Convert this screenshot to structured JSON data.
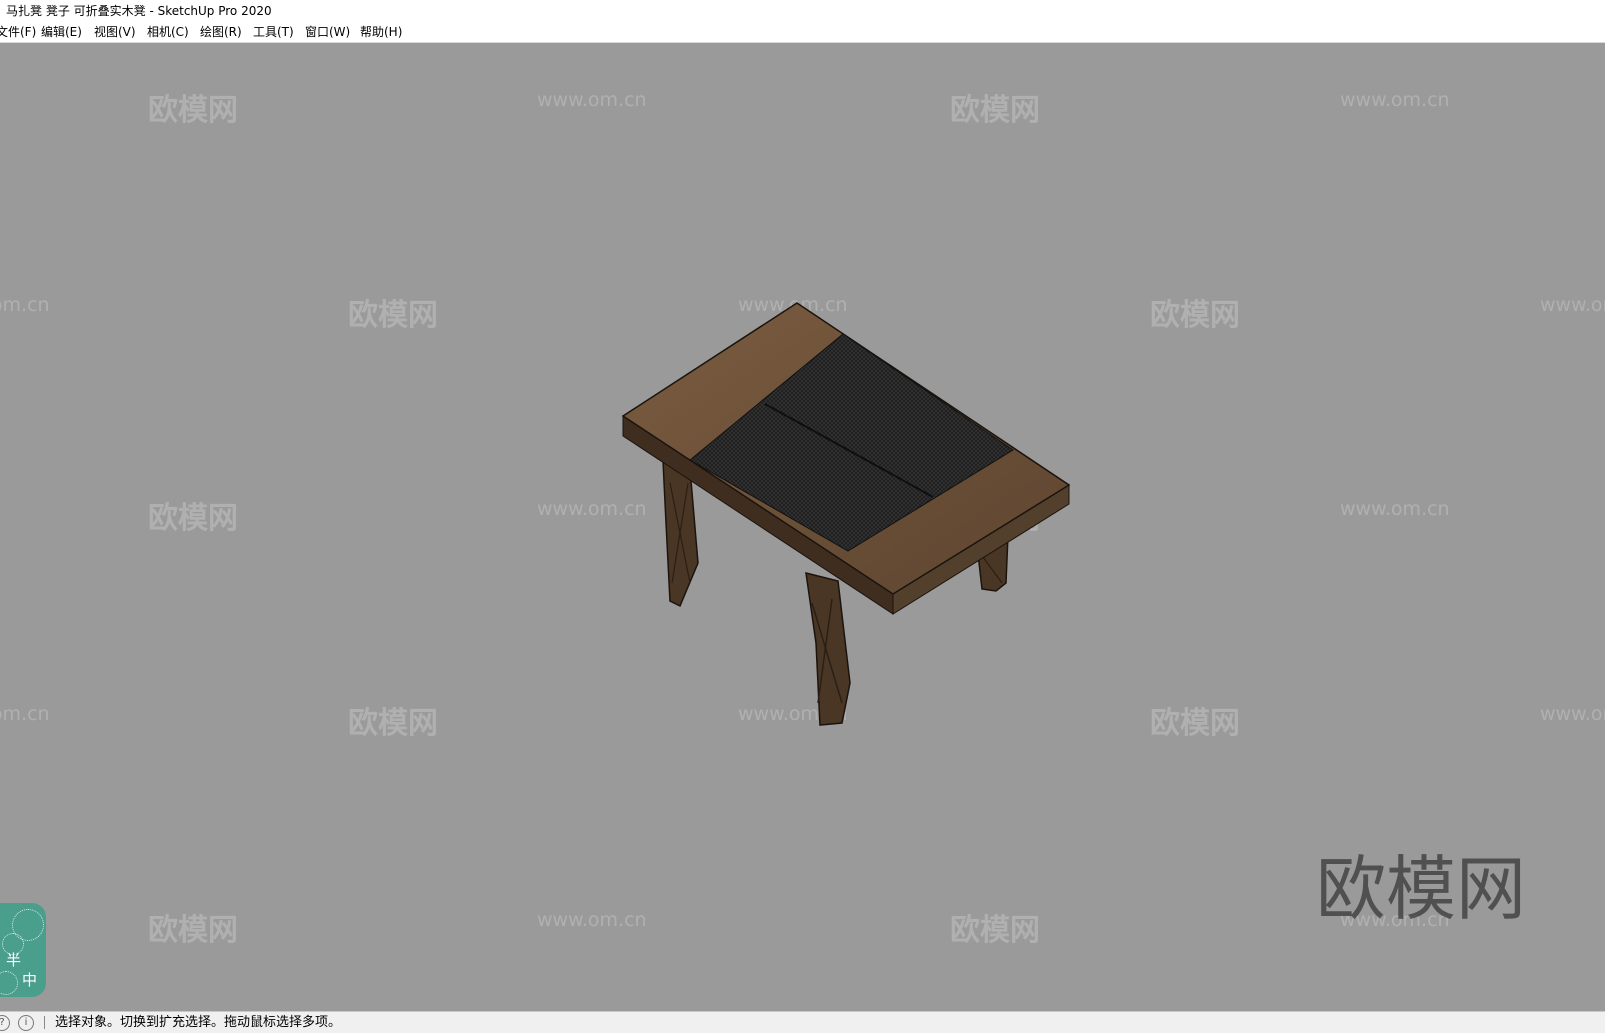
{
  "window": {
    "title": "马扎凳 凳子 可折叠实木凳 - SketchUp Pro 2020"
  },
  "menu": [
    {
      "label": "文件(F)"
    },
    {
      "label": "编辑(E)"
    },
    {
      "label": "视图(V)"
    },
    {
      "label": "相机(C)"
    },
    {
      "label": "绘图(R)"
    },
    {
      "label": "工具(T)"
    },
    {
      "label": "窗口(W)"
    },
    {
      "label": "帮助(H)"
    }
  ],
  "watermark": {
    "logo_text": "欧模网",
    "url_text": "www.om.cn",
    "brand_text": "欧模网"
  },
  "badge": {
    "text_1": "半",
    "text_2": "中"
  },
  "status": {
    "message": "选择对象。切换到扩充选择。拖动鼠标选择多项。"
  },
  "colors": {
    "viewport": "#9a9a9a",
    "wood": "#6b5038",
    "seat_weave": "#1e1e1e",
    "badge": "#4a9e8c"
  }
}
